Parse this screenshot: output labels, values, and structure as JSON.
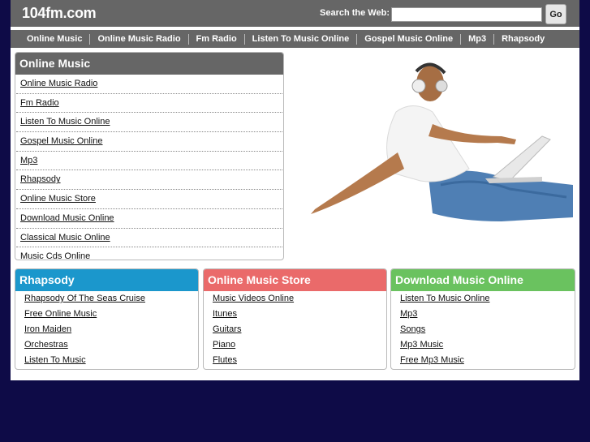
{
  "header": {
    "logo": "104fm.com",
    "search_label": "Search the Web:",
    "search_value": "",
    "go_label": "Go"
  },
  "nav": [
    "Online Music",
    "Online Music Radio",
    "Fm Radio",
    "Listen To Music Online",
    "Gospel Music Online",
    "Mp3",
    "Rhapsody"
  ],
  "main_box": {
    "title": "Online Music",
    "links": [
      "Online Music Radio",
      "Fm Radio",
      "Listen To Music Online",
      "Gospel Music Online",
      "Mp3",
      "Rhapsody",
      "Online Music Store",
      "Download Music Online",
      "Classical Music Online",
      "Music Cds Online"
    ]
  },
  "columns": [
    {
      "title": "Rhapsody",
      "links": [
        "Rhapsody Of The Seas Cruise",
        "Free Online Music",
        "Iron Maiden",
        "Orchestras",
        "Listen To Music"
      ]
    },
    {
      "title": "Online Music Store",
      "links": [
        "Music Videos Online",
        "Itunes",
        "Guitars",
        "Piano",
        "Flutes"
      ]
    },
    {
      "title": "Download Music Online",
      "links": [
        "Listen To Music Online",
        "Mp3",
        "Songs",
        "Mp3 Music",
        "Free Mp3 Music"
      ]
    }
  ],
  "colors": {
    "background": "#0e0b47",
    "header": "#666666",
    "rhapsody": "#1b97cc",
    "store": "#ea6a6a",
    "download": "#6ac25f"
  }
}
